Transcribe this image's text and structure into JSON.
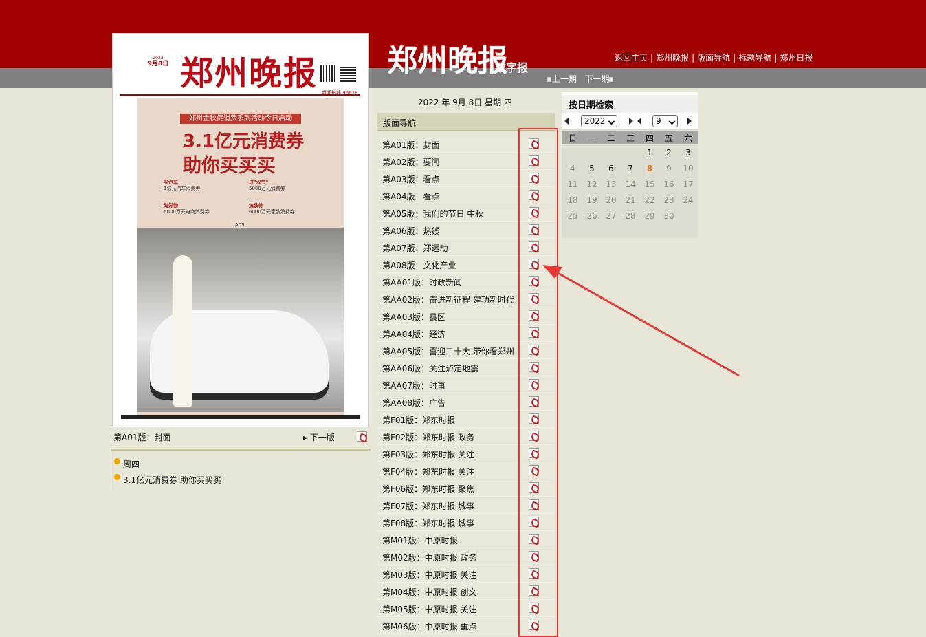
{
  "header": {
    "logo_text": "郑州晚报",
    "logo_sub": "数字报",
    "links": [
      "返回主页",
      "郑州晚报",
      "版面导航",
      "标题导航",
      "郑州日报"
    ],
    "prev_issue": "上一期",
    "next_issue": "下一期"
  },
  "paper": {
    "masthead": "郑州晚报",
    "mast_date_line1": "2022",
    "mast_date_line2": "9月8日",
    "mast_hotline": "新闻热线 96678",
    "banner": "郑州金秋促消费系列活动今日启动",
    "headline1": "3.1亿元消费券",
    "headline2": "助你买买买",
    "blurb1_title": "买汽车",
    "blurb1": "1亿元汽车消费券",
    "blurb2_title": "过\"双节\"",
    "blurb2": "5000万元消费券",
    "blurb3_title": "淘好物",
    "blurb3": "6000万元电商消费券",
    "blurb4_title": "搞装修",
    "blurb4": "6000万元家装消费券",
    "page_ref": "A03"
  },
  "under_paper": {
    "label": "第A01版：封面",
    "next": "下一版"
  },
  "summary": {
    "items": [
      "周四",
      "3.1亿元消费券 助你买买买"
    ]
  },
  "date_line": "2022 年 9月 8日   星期 四",
  "nav": {
    "title": "版面导航",
    "items": [
      "第A01版：封面",
      "第A02版：要闻",
      "第A03版：看点",
      "第A04版：看点",
      "第A05版：我们的节日 中秋",
      "第A06版：热线",
      "第A07版：郑运动",
      "第A08版：文化产业",
      "第AA01版：时政新闻",
      "第AA02版：奋进新征程 建功新时代",
      "第AA03版：县区",
      "第AA04版：经济",
      "第AA05版：喜迎二十大 带你看郑州",
      "第AA06版：关注泸定地震",
      "第AA07版：时事",
      "第AA08版：广告",
      "第F01版：郑东时报",
      "第F02版：郑东时报 政务",
      "第F03版：郑东时报 关注",
      "第F04版：郑东时报 关注",
      "第F06版：郑东时报 聚焦",
      "第F07版：郑东时报 城事",
      "第F08版：郑东时报 城事",
      "第M01版：中原时报",
      "第M02版：中原时报 政务",
      "第M03版：中原时报 关注",
      "第M04版：中原时报 创文",
      "第M05版：中原时报 关注",
      "第M06版：中原时报 重点"
    ]
  },
  "calendar": {
    "title": "按日期检索",
    "year": "2022",
    "month": "9",
    "weekdays": [
      "日",
      "一",
      "二",
      "三",
      "四",
      "五",
      "六"
    ],
    "rows": [
      [
        "",
        "",
        "",
        "",
        "1",
        "2",
        "3"
      ],
      [
        "4",
        "5",
        "6",
        "7",
        "8",
        "9",
        "10"
      ],
      [
        "11",
        "12",
        "13",
        "14",
        "15",
        "16",
        "17"
      ],
      [
        "18",
        "19",
        "20",
        "21",
        "22",
        "23",
        "24"
      ],
      [
        "25",
        "26",
        "27",
        "28",
        "29",
        "30",
        ""
      ]
    ]
  },
  "colors": {
    "header_red": "#a30000",
    "header_gray": "#7f7f7f",
    "page_bg": "#e8e6d6",
    "today": "#e6731b",
    "annotation": "#e53935"
  }
}
